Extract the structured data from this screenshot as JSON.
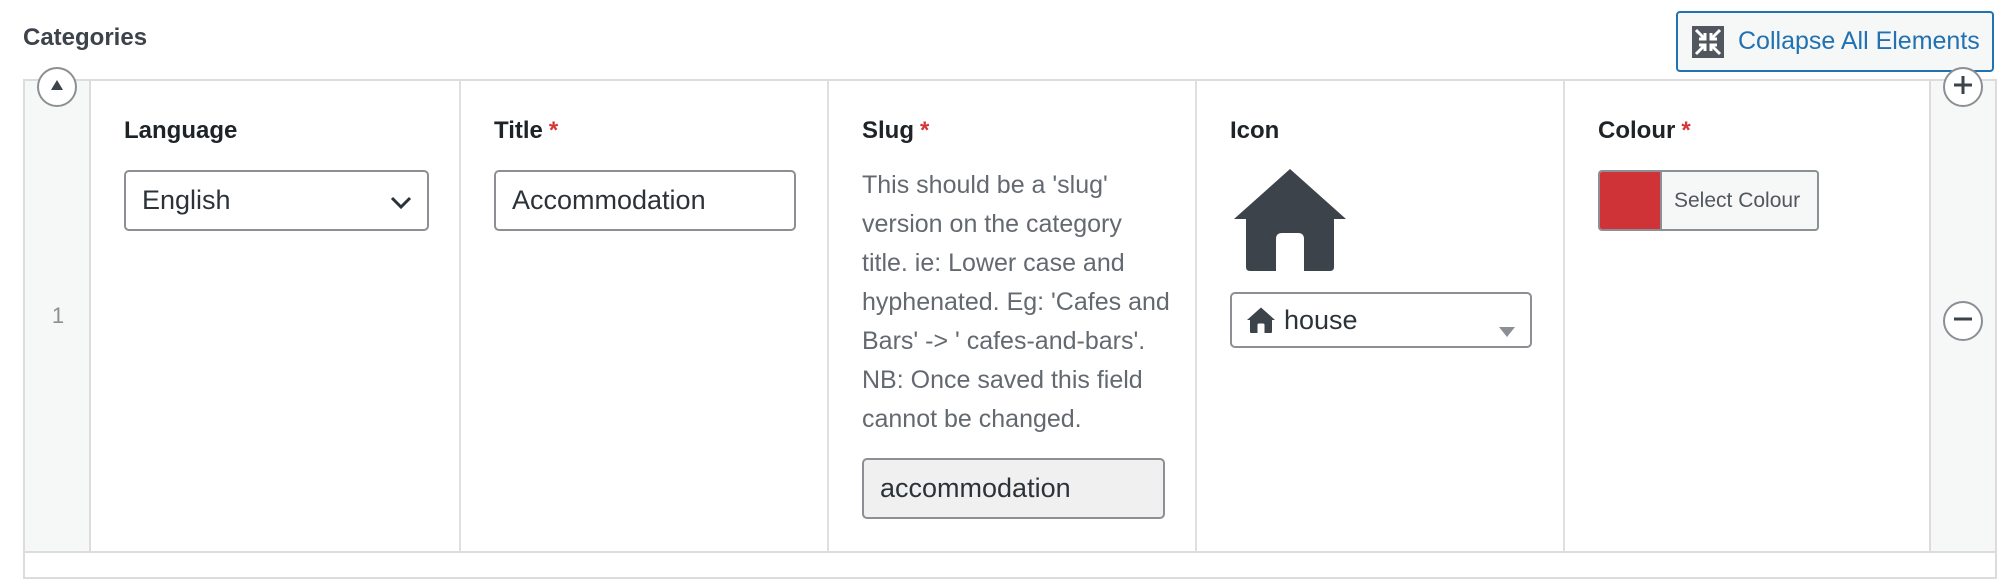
{
  "section": {
    "title": "Categories"
  },
  "toolbar": {
    "collapse_label": "Collapse All Elements"
  },
  "row": {
    "number": "1",
    "language": {
      "label": "Language",
      "value": "English"
    },
    "title": {
      "label": "Title",
      "required": "*",
      "value": "Accommodation"
    },
    "slug": {
      "label": "Slug",
      "required": "*",
      "description": "This should be a 'slug' version on the category title. ie: Lower case and hyphenated. Eg: 'Cafes and Bars' -> ' cafes-and-bars'. NB: Once saved this field cannot be changed.",
      "value": "accommodation"
    },
    "icon": {
      "label": "Icon",
      "icon_name": "house-icon",
      "selected": "house"
    },
    "colour": {
      "label": "Colour",
      "required": "*",
      "button_label": "Select Colour",
      "value": "#d03337"
    }
  },
  "colors": {
    "accent": "#2271b1",
    "required": "#d63638",
    "icon": "#3c434a"
  }
}
